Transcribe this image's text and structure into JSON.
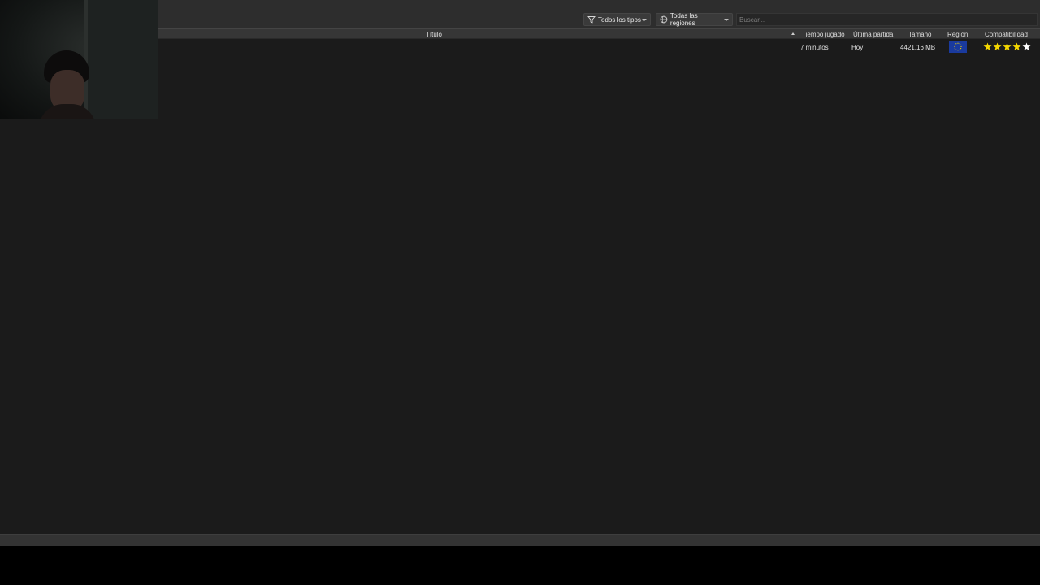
{
  "toolbar": {
    "type_filter": {
      "label": "Todos los tipos",
      "icon": "filter-icon"
    },
    "region_filter": {
      "label": "Todas las regiones",
      "icon": "globe-icon"
    },
    "search": {
      "placeholder": "Buscar...",
      "value": ""
    }
  },
  "table": {
    "columns": {
      "title": "Título",
      "play_time": "Tiempo jugado",
      "last_played": "Última partida",
      "size": "Tamaño",
      "region": "Región",
      "compatibility": "Compatibilidad"
    },
    "sort": {
      "column": "title",
      "direction": "ascending"
    },
    "rows": [
      {
        "title": "",
        "play_time": "7 minutos",
        "last_played": "Hoy",
        "size": "4421.16 MB",
        "region_icon": "eu-flag-icon",
        "compatibility_stars": 5
      }
    ]
  },
  "colors": {
    "star_filled": "#f5d800",
    "flag_blue": "#1a3a9e",
    "flag_star": "#f5d800"
  }
}
